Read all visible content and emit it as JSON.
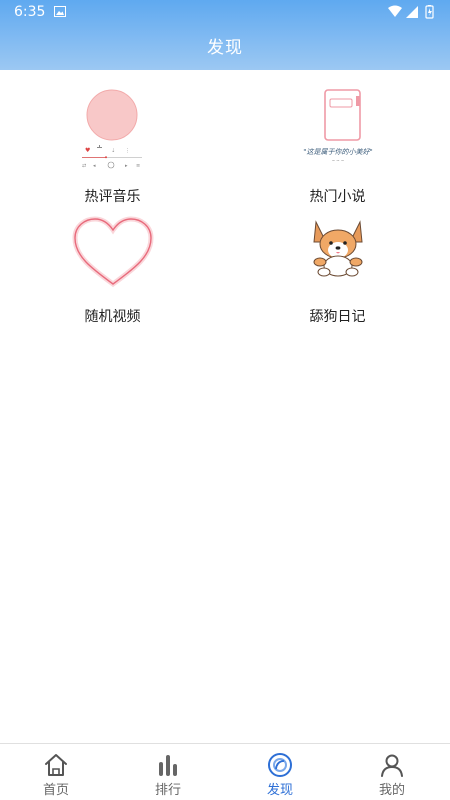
{
  "status_bar": {
    "time": "6:35"
  },
  "header": {
    "title": "发现"
  },
  "tiles": [
    {
      "label": "热评音乐"
    },
    {
      "label": "热门小说",
      "image_caption": "\"这是属于你的小美好\""
    },
    {
      "label": "随机视频"
    },
    {
      "label": "舔狗日记"
    }
  ],
  "bottom_nav": [
    {
      "label": "首页",
      "icon": "home-icon"
    },
    {
      "label": "排行",
      "icon": "bar-chart-icon"
    },
    {
      "label": "发现",
      "icon": "discover-icon"
    },
    {
      "label": "我的",
      "icon": "user-icon"
    }
  ],
  "colors": {
    "header_top": "#5fa9f0",
    "header_bottom": "#9cc8f3",
    "active_nav": "#2d6fd6",
    "inactive_nav": "#666666"
  }
}
